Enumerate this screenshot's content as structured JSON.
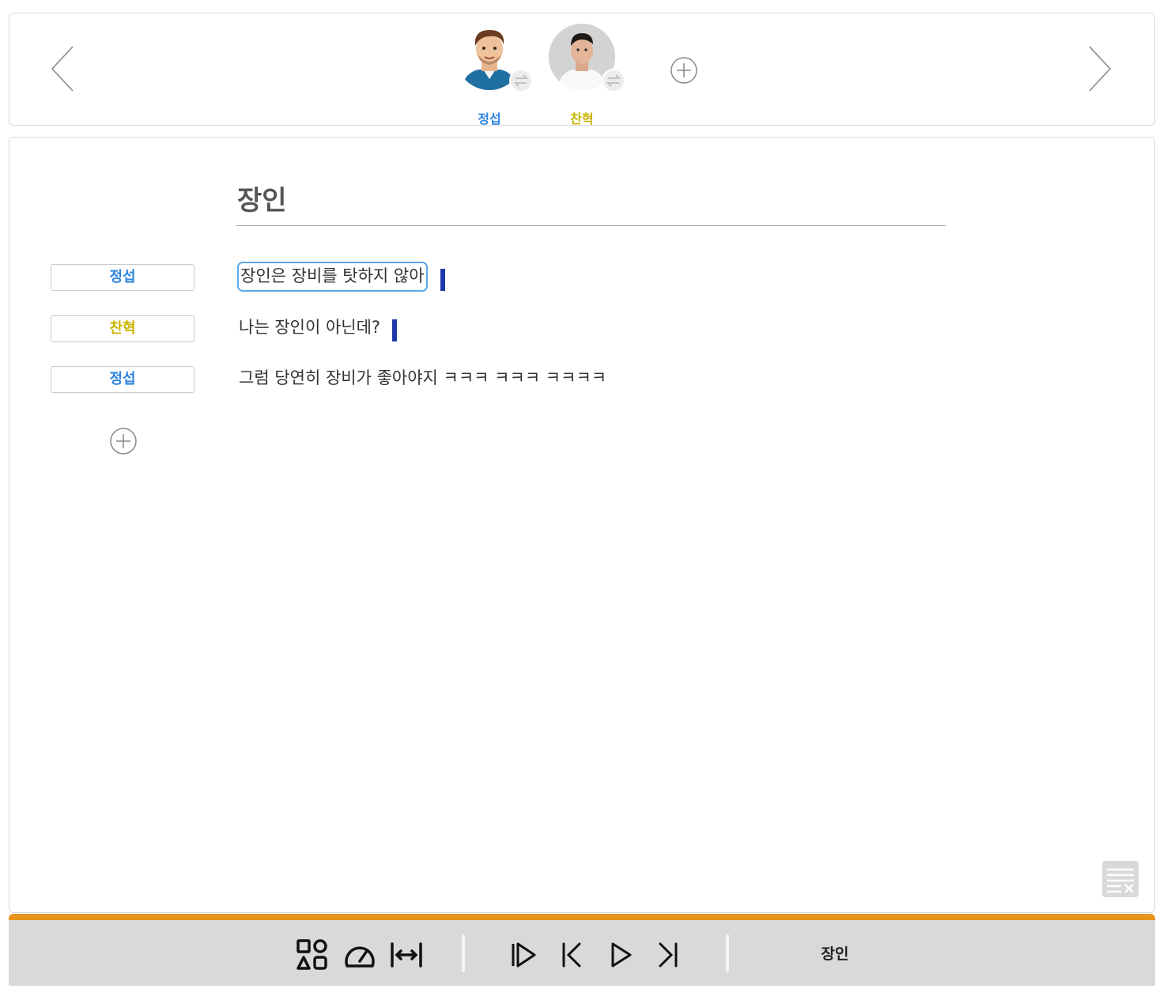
{
  "cast": {
    "members": [
      {
        "name": "정섭",
        "color": "#2e86de"
      },
      {
        "name": "찬혁",
        "color": "#c8b400"
      }
    ]
  },
  "script": {
    "title": "장인",
    "lines": [
      {
        "speaker": "정섭",
        "text": "장인은  장비를 탓하지 않아",
        "active": true
      },
      {
        "speaker": "찬혁",
        "text": "나는 장인이 아닌데?",
        "active": false
      },
      {
        "speaker": "정섭",
        "text": "그럼 당연히 장비가 좋아야지 ㅋㅋㅋ ㅋㅋㅋ ㅋㅋㅋㅋ",
        "active": false
      }
    ]
  },
  "toolbar": {
    "current_title": "장인"
  },
  "colors": {
    "accent_orange": "#e8941a",
    "speaker_jeongseop": "#2e86de",
    "speaker_chanhyeok": "#c8b400",
    "line_marker": "#1e3aa8",
    "active_border": "#5aa8e8"
  }
}
